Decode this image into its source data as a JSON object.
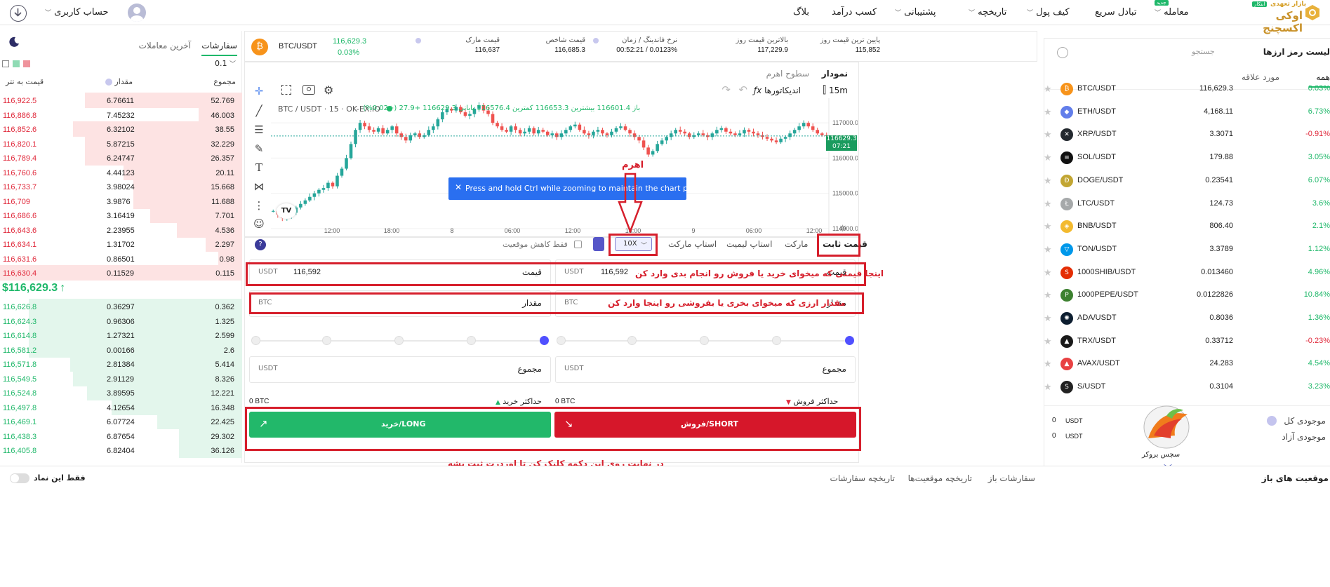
{
  "nav": {
    "brand_name": "اوکی اکسچنج",
    "brand_tag": "بازار تعهدی",
    "brand_badge": "ابتکار",
    "items": [
      {
        "label": "معامله",
        "badge": "جدید",
        "caret": true
      },
      {
        "label": "تبادل سریع",
        "caret": false
      },
      {
        "label": "کیف پول",
        "caret": true
      },
      {
        "label": "تاریخچه",
        "caret": true
      },
      {
        "label": "پشتیبانی",
        "caret": true
      },
      {
        "label": "کسب درآمد",
        "caret": false
      },
      {
        "label": "بلاگ",
        "caret": false
      }
    ],
    "account_label": "حساب کاربری"
  },
  "ticker": {
    "pair": "BTC/USDT",
    "price": "116,629.3",
    "change": "0.03%",
    "stats": [
      {
        "label": "قیمت مارک",
        "value": "116,637"
      },
      {
        "label": "قیمت شاخص",
        "value": "116,685.3"
      },
      {
        "label": "نرخ فاندینگ / زمان",
        "value": "00:52:21 / 0.0123%"
      },
      {
        "label": "بالاترین قیمت روز",
        "value": "117,229.9"
      },
      {
        "label": "پایین ترین قیمت روز",
        "value": "115,852"
      }
    ]
  },
  "markets": {
    "title": "لیست رمز ارزها",
    "search_placeholder": "جستجو",
    "tabs": [
      "همه",
      "مورد علاقه"
    ],
    "rows": [
      {
        "symbol": "BTC/USDT",
        "price": "116,629.3",
        "change": "0.03%",
        "dir": "up",
        "color": "#f7931a",
        "glyph": "₿"
      },
      {
        "symbol": "ETH/USDT",
        "price": "4,168.11",
        "change": "6.73%",
        "dir": "up",
        "color": "#627eea",
        "glyph": "◆"
      },
      {
        "symbol": "XRP/USDT",
        "price": "3.3071",
        "change": "-0.91%",
        "dir": "down",
        "color": "#23292f",
        "glyph": "✕"
      },
      {
        "symbol": "SOL/USDT",
        "price": "179.88",
        "change": "3.05%",
        "dir": "up",
        "color": "#111111",
        "glyph": "≡"
      },
      {
        "symbol": "DOGE/USDT",
        "price": "0.23541",
        "change": "6.07%",
        "dir": "up",
        "color": "#c2a633",
        "glyph": "Ð"
      },
      {
        "symbol": "LTC/USDT",
        "price": "124.73",
        "change": "3.6%",
        "dir": "up",
        "color": "#a6a9aa",
        "glyph": "Ł"
      },
      {
        "symbol": "BNB/USDT",
        "price": "806.40",
        "change": "2.1%",
        "dir": "up",
        "color": "#f3ba2f",
        "glyph": "◈"
      },
      {
        "symbol": "TON/USDT",
        "price": "3.3789",
        "change": "1.12%",
        "dir": "up",
        "color": "#0098ea",
        "glyph": "▽"
      },
      {
        "symbol": "1000SHIB/USDT",
        "price": "0.013460",
        "change": "4.96%",
        "dir": "up",
        "color": "#e42d04",
        "glyph": "S"
      },
      {
        "symbol": "1000PEPE/USDT",
        "price": "0.0122826",
        "change": "10.84%",
        "dir": "up",
        "color": "#3d8130",
        "glyph": "P"
      },
      {
        "symbol": "ADA/USDT",
        "price": "0.8036",
        "change": "1.36%",
        "dir": "up",
        "color": "#0d1e30",
        "glyph": "✺"
      },
      {
        "symbol": "TRX/USDT",
        "price": "0.33712",
        "change": "-0.23%",
        "dir": "down",
        "color": "#1a1a1a",
        "glyph": "▲"
      },
      {
        "symbol": "AVAX/USDT",
        "price": "24.283",
        "change": "4.54%",
        "dir": "up",
        "color": "#e84142",
        "glyph": "▲"
      },
      {
        "symbol": "S/USDT",
        "price": "0.3104",
        "change": "3.23%",
        "dir": "up",
        "color": "#222222",
        "glyph": "S"
      }
    ]
  },
  "wallet": {
    "total_label": "موجودی کل",
    "free_label": "موجودی آزاد",
    "total_value": "0",
    "free_value": "0",
    "unit": "USDT",
    "watermark": "سچس بروکر"
  },
  "orderbook": {
    "tabs": [
      "سفارشات",
      "آخرین معاملات"
    ],
    "precision": "0.1",
    "headers": [
      "قیمت به تتر",
      "مقدار",
      "مجموع"
    ],
    "asks": [
      {
        "price": "116,922.5",
        "qty": "6.76611",
        "total": "52.769",
        "depth": 0.35
      },
      {
        "price": "116,886.8",
        "qty": "7.45232",
        "total": "46.003",
        "depth": 0.82
      },
      {
        "price": "116,852.6",
        "qty": "6.32102",
        "total": "38.55",
        "depth": 0.3
      },
      {
        "price": "116,820.1",
        "qty": "5.87215",
        "total": "32.229",
        "depth": 0.35
      },
      {
        "price": "116,789.4",
        "qty": "6.24747",
        "total": "26.357",
        "depth": 0.35
      },
      {
        "price": "116,760.6",
        "qty": "4.44123",
        "total": "20.11",
        "depth": 0.51
      },
      {
        "price": "116,733.7",
        "qty": "3.98024",
        "total": "15.668",
        "depth": 0.55
      },
      {
        "price": "116,709",
        "qty": "3.9876",
        "total": "11.688",
        "depth": 0.55
      },
      {
        "price": "116,686.6",
        "qty": "3.16419",
        "total": "7.701",
        "depth": 0.62
      },
      {
        "price": "116,643.6",
        "qty": "2.23955",
        "total": "4.536",
        "depth": 0.73
      },
      {
        "price": "116,634.1",
        "qty": "1.31702",
        "total": "2.297",
        "depth": 0.85
      },
      {
        "price": "116,631.6",
        "qty": "0.86501",
        "total": "0.98",
        "depth": 0.9
      },
      {
        "price": "116,630.4",
        "qty": "0.11529",
        "total": "0.115",
        "depth": 0.0
      }
    ],
    "last_price": "$116,629.3",
    "bids": [
      {
        "price": "116,626.8",
        "qty": "0.36297",
        "total": "0.362",
        "depth": 0.12
      },
      {
        "price": "116,624.3",
        "qty": "0.96306",
        "total": "1.325",
        "depth": 0.12
      },
      {
        "price": "116,614.8",
        "qty": "1.27321",
        "total": "2.599",
        "depth": 0.12
      },
      {
        "price": "116,581.2",
        "qty": "0.00166",
        "total": "2.6",
        "depth": 0.12
      },
      {
        "price": "116,571.8",
        "qty": "2.81384",
        "total": "5.414",
        "depth": 0.29
      },
      {
        "price": "116,549.5",
        "qty": "2.91129",
        "total": "8.326",
        "depth": 0.3
      },
      {
        "price": "116,524.8",
        "qty": "3.89595",
        "total": "12.221",
        "depth": 0.36
      },
      {
        "price": "116,497.8",
        "qty": "4.12654",
        "total": "16.348",
        "depth": 0.46
      },
      {
        "price": "116,469.1",
        "qty": "6.07724",
        "total": "22.425",
        "depth": 0.65
      },
      {
        "price": "116,438.3",
        "qty": "6.87654",
        "total": "29.302",
        "depth": 0.74
      },
      {
        "price": "116,405.8",
        "qty": "6.82404",
        "total": "36.126",
        "depth": 0.74
      }
    ]
  },
  "chart": {
    "tabs": [
      "نمودار",
      "سطوح اهرم"
    ],
    "interval": "15m",
    "indicators_label": "اندیکاتورها",
    "legend_symbol": "BTC / USDT · 15 · OK-EX.IO",
    "legend_ohlc": "باز 116601.4 بیشترین 116653.3 کمترین 116576.4 پایانی 116629.3 +27.9 (+0.02%)",
    "price_tag": "116629.3",
    "price_timer": "07:21",
    "y_ticks": [
      "117000.0",
      "116000.0",
      "115000.0",
      "114000.0"
    ],
    "x_ticks": [
      "12:00",
      "18:00",
      "8",
      "06:00",
      "12:00",
      "18:00",
      "9",
      "06:00",
      "12:00"
    ],
    "toast": "Press and hold Ctrl while zooming to maintain the chart position",
    "logo": "TV"
  },
  "chart_data": {
    "type": "candlestick",
    "title": "BTC / USDT · 15 · OK-EX.IO",
    "ylim": [
      113800,
      117700
    ],
    "y_ticks": [
      114000,
      115000,
      116000,
      117000
    ],
    "close_series": [
      114500,
      114400,
      114300,
      114350,
      114450,
      114600,
      114700,
      114800,
      114900,
      115000,
      115100,
      115150,
      115300,
      115200,
      115500,
      115700,
      116000,
      116400,
      116800,
      117000,
      116900,
      116800,
      116750,
      116850,
      116700,
      116800,
      116900,
      116700,
      116600,
      116500,
      116650,
      116700,
      116600,
      116650,
      116800,
      116900,
      117100,
      117300,
      117400,
      117350,
      117450,
      117300,
      117200,
      117250,
      117400,
      117500,
      117350,
      117250,
      117000,
      116900,
      116800,
      116750,
      116900,
      116800,
      116700,
      116750,
      116850,
      116700,
      116800,
      116750,
      116650,
      116700,
      116600,
      116700,
      116800,
      116900,
      116950,
      116800,
      116700,
      116650,
      116750,
      116800,
      116700,
      116650,
      116750,
      116850,
      116900,
      116800,
      116700,
      116600,
      116500,
      116300,
      116100,
      116200,
      116400,
      116500,
      116600,
      116700,
      116800,
      116750,
      116700,
      116600,
      116650,
      116700,
      116650,
      116600,
      116700,
      116800,
      116850,
      116750,
      116700,
      116650,
      116700,
      116800,
      116750,
      116700,
      116650,
      116600,
      116550,
      116500,
      116450,
      116550,
      116600,
      116700,
      116800,
      116900,
      117000,
      116900,
      116800,
      116700,
      116650,
      116629
    ]
  },
  "trade": {
    "order_types": [
      "قیمت ثابت",
      "مارکت",
      "استاپ لیمیت",
      "استاپ مارکت"
    ],
    "leverage": "10X",
    "reduce_only_label": "فقط کاهش موقعیت",
    "sell": {
      "price_label": "قیمت",
      "price_value": "116,592",
      "price_unit": "USDT",
      "amount_label": "مقدار",
      "amount_unit": "BTC",
      "total_label": "مجموع",
      "total_unit": "USDT",
      "max_label": "حداکثر فروش",
      "max_value": "0 BTC",
      "button": "فروش/SHORT"
    },
    "buy": {
      "price_label": "قیمت",
      "price_value": "116,592",
      "price_unit": "USDT",
      "amount_label": "مقدار",
      "amount_unit": "BTC",
      "total_label": "مجموع",
      "total_unit": "USDT",
      "max_label": "حداکثر خرید",
      "max_value": "0 BTC",
      "button": "خرید/LONG"
    }
  },
  "annotations": {
    "leverage": "اهرم",
    "price_hint": "اینجا قیمتی که میخوای خرید یا فروش رو انجام بدی وارد کن",
    "amount_hint": "مقدار ارزی که میخوای بخری یا بفروشی  رو اینجا وارد کن",
    "final_hint": "در نهایت روی این دکمه کلیک کن تا اوردرت ثبت بشه"
  },
  "bottom": {
    "tabs": [
      "موقعیت های باز",
      "سفارشات باز",
      "تاریخچه موقعیت‌ها",
      "تاریخچه سفارشات"
    ],
    "toggle_label": "فقط این نماد"
  }
}
